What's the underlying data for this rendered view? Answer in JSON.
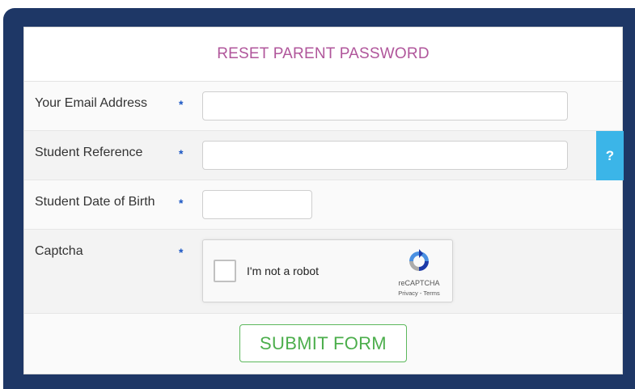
{
  "form": {
    "title": "RESET PARENT PASSWORD",
    "required_marker": "*",
    "fields": [
      {
        "label": "Your Email Address",
        "value": ""
      },
      {
        "label": "Student Reference",
        "value": ""
      },
      {
        "label": "Student Date of Birth",
        "value": ""
      },
      {
        "label": "Captcha"
      }
    ],
    "help_button": "?",
    "captcha": {
      "checkbox_label": "I'm not a robot",
      "brand": "reCAPTCHA",
      "links": "Privacy - Terms"
    },
    "submit_label": "SUBMIT FORM"
  },
  "colors": {
    "frame": "#1e3766",
    "title": "#b0569b",
    "required": "#1a56c4",
    "help": "#3bb5e8",
    "submit": "#5cb85c"
  }
}
